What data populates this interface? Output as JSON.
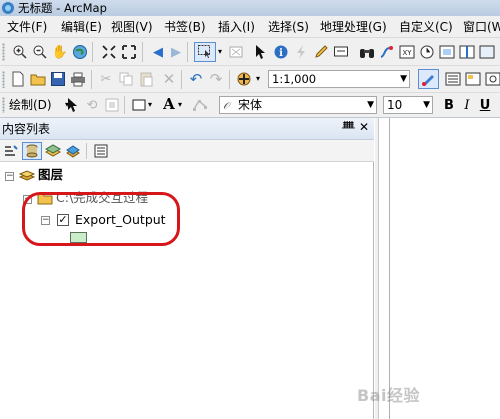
{
  "window": {
    "title": "无标题 - ArcMap"
  },
  "menubar": {
    "items": [
      "文件(F)",
      "编辑(E)",
      "视图(V)",
      "书签(B)",
      "插入(I)",
      "选择(S)",
      "地理处理(G)",
      "自定义(C)",
      "窗口(W"
    ]
  },
  "toolbar2": {
    "scale": "1:1,000"
  },
  "toolbar3": {
    "draw_label": "绘制(D)",
    "font_name": "宋体",
    "font_size": "10",
    "bold": "B",
    "italic": "I",
    "underline": "U"
  },
  "toc": {
    "title": "内容列表",
    "layers_label": "图层",
    "folder_label": "C:\\完成交互过程",
    "layer_name": "Export_Output",
    "layer_checked": true,
    "symbol_color": "#c9ecc9"
  },
  "watermark": "Bai经验"
}
